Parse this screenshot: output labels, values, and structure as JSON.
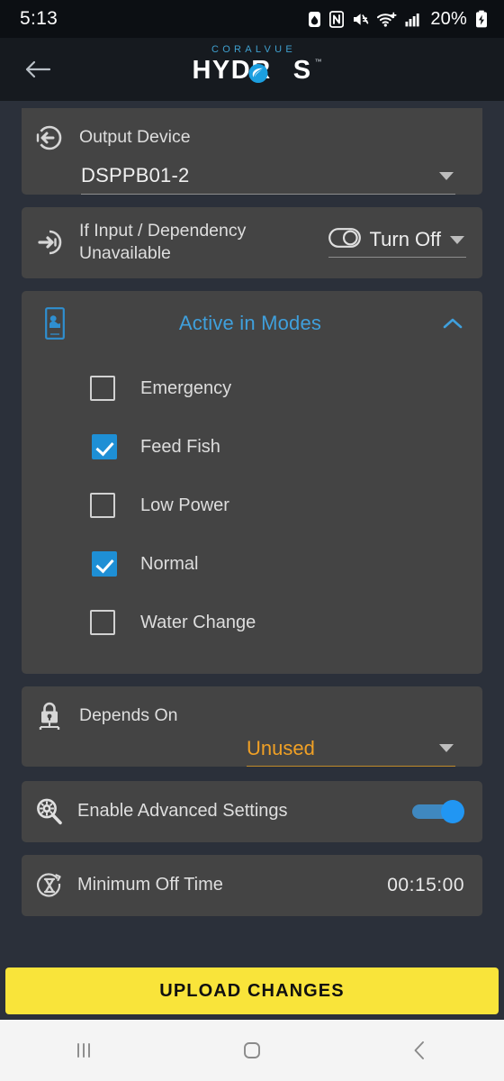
{
  "status_bar": {
    "time": "5:13",
    "battery_percent": "20%",
    "icons": [
      "water-drop-icon",
      "nfc-icon",
      "mute-icon",
      "wifi-icon",
      "cellular-signal-icon",
      "battery-charging-icon"
    ]
  },
  "app_bar": {
    "back_icon": "back-arrow-icon",
    "brand_top": "CORALVUE",
    "brand_main_left": "HYDR",
    "brand_main_right": "S",
    "brand_tm": "™"
  },
  "output_device": {
    "icon": "output-arrow-icon",
    "label": "Output Device",
    "value": "DSPPB01-2",
    "caret_icon": "chevron-down-icon"
  },
  "dependency": {
    "icon": "input-arrow-icon",
    "label_line1": "If Input / Dependency",
    "label_line2": "Unavailable",
    "toggle_icon": "toggle-switch-icon",
    "value": "Turn Off",
    "caret_icon": "chevron-down-icon"
  },
  "active_in_modes": {
    "icon": "tablet-wave-icon",
    "title": "Active in Modes",
    "collapse_icon": "chevron-up-icon",
    "items": [
      {
        "label": "Emergency",
        "checked": false
      },
      {
        "label": "Feed Fish",
        "checked": true
      },
      {
        "label": "Low Power",
        "checked": false
      },
      {
        "label": "Normal",
        "checked": true
      },
      {
        "label": "Water Change",
        "checked": false
      }
    ]
  },
  "depends_on": {
    "icon": "lock-network-icon",
    "label": "Depends On",
    "value": "Unused",
    "caret_icon": "chevron-down-icon"
  },
  "advanced_settings": {
    "icon": "gear-magnifier-icon",
    "label": "Enable Advanced Settings",
    "toggle_on": true
  },
  "minimum_off_time": {
    "icon": "hourglass-icon",
    "label": "Minimum Off Time",
    "value": "00:15:00"
  },
  "upload": {
    "label": "UPLOAD CHANGES"
  },
  "nav_bar": {
    "recents_icon": "recents-icon",
    "home_icon": "home-icon",
    "back_icon": "back-icon"
  },
  "colors": {
    "page_background": "#2b303a",
    "card_background": "#444444",
    "accent_blue": "#3fa0dd",
    "accent_orange": "#f0a025",
    "upload_yellow": "#f9e43a",
    "checkbox_checked": "#1e8fd5",
    "status_bar_bg": "#0c0f13",
    "app_bar_bg": "#161a1f",
    "nav_bar_bg": "#f4f4f4"
  }
}
